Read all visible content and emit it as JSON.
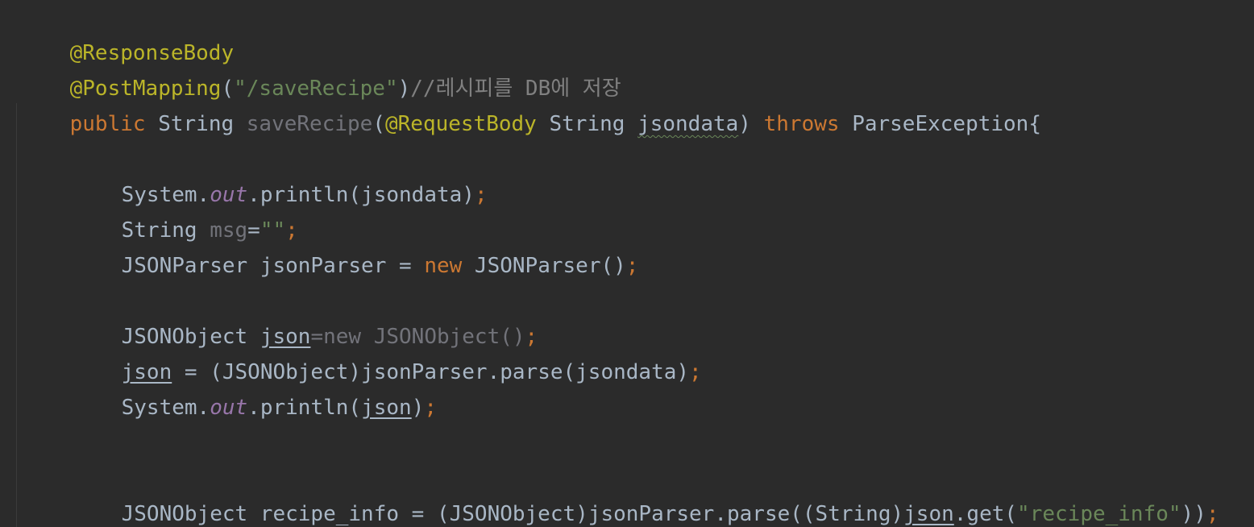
{
  "colors": {
    "background": "#2b2b2b",
    "default_text": "#a9b7c6",
    "annotation": "#bbb529",
    "keyword": "#cc7832",
    "string": "#6a8759",
    "comment": "#808080",
    "unused": "#72737a",
    "static_field": "#9876aa"
  },
  "code": {
    "l1": {
      "ann": "@ResponseBody"
    },
    "l2": {
      "ann": "@PostMapping",
      "open": "(",
      "str": "\"/saveRecipe\"",
      "close": ")",
      "comment": "//레시피를 DB에 저장"
    },
    "l3": {
      "kw": "public",
      "type": "String",
      "method": "saveRecipe",
      "open": "(",
      "ann": "@RequestBody",
      "ptype": "String",
      "param": "jsondata",
      "close": ")",
      "throws": "throws",
      "exc": "ParseException{"
    },
    "l5": {
      "cls": "System.",
      "field": "out",
      "call": ".println(jsondata)",
      "semi": ";"
    },
    "l6": {
      "type": "String",
      "var": "msg",
      "eq": "=",
      "str": "\"\"",
      "semi": ";"
    },
    "l7": {
      "decl": "JSONParser jsonParser = ",
      "kw": "new",
      "ctor": " JSONParser()",
      "semi": ";"
    },
    "l9": {
      "type": "JSONObject ",
      "var": "json",
      "init": "=new JSONObject()",
      "semi": ";"
    },
    "l10": {
      "var": "json",
      "rest": " = (JSONObject)jsonParser.parse(jsondata)",
      "semi": ";"
    },
    "l11": {
      "cls": "System.",
      "field": "out",
      "call1": ".println(",
      "var": "json",
      "call2": ")",
      "semi": ";"
    },
    "l14": {
      "decl": "JSONObject recipe_info = (JSONObject)jsonParser.parse((String)",
      "var": "json",
      "call": ".get(",
      "str": "\"recipe_info\"",
      "close": "))",
      "semi": ";"
    }
  }
}
